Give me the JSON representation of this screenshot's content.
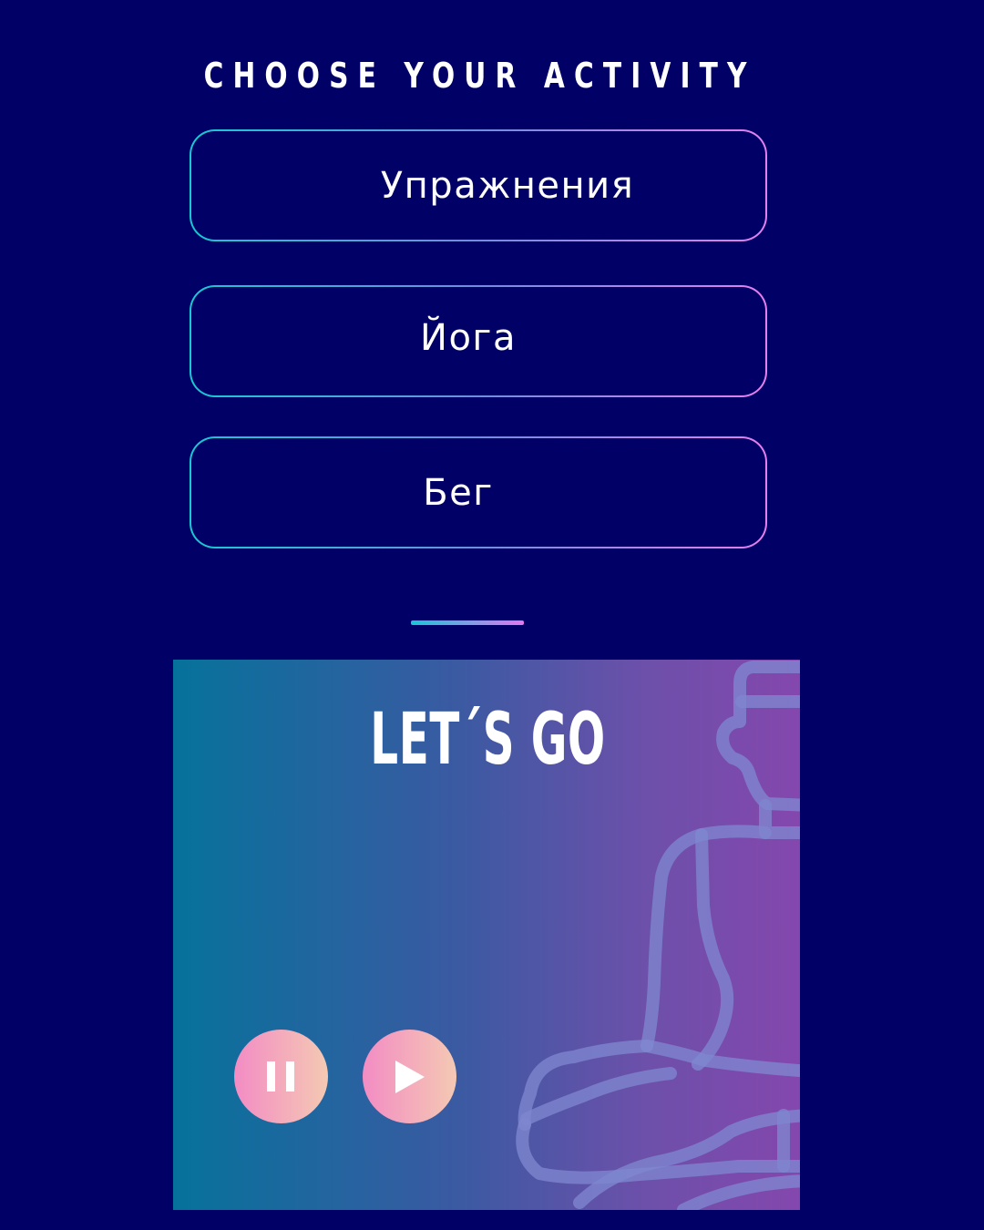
{
  "header": {
    "title": "CHOOSE YOUR ACTIVITY"
  },
  "activities": [
    {
      "label": "Упражнения"
    },
    {
      "label": "Йога"
    },
    {
      "label": "Бег"
    }
  ],
  "player": {
    "title": "LET´S GO",
    "controls": {
      "pause_icon": "pause-icon",
      "play_icon": "play-icon"
    },
    "illustration_icon": "meditation-figure-icon"
  },
  "colors": {
    "background": "#000066",
    "border_gradient_start": "#17c9d3",
    "border_gradient_end": "#e67ff0",
    "card_gradient_start": "#06729b",
    "card_gradient_end": "#8447ad",
    "button_gradient_start": "#f38cc4",
    "button_gradient_end": "#f4c9b3"
  }
}
